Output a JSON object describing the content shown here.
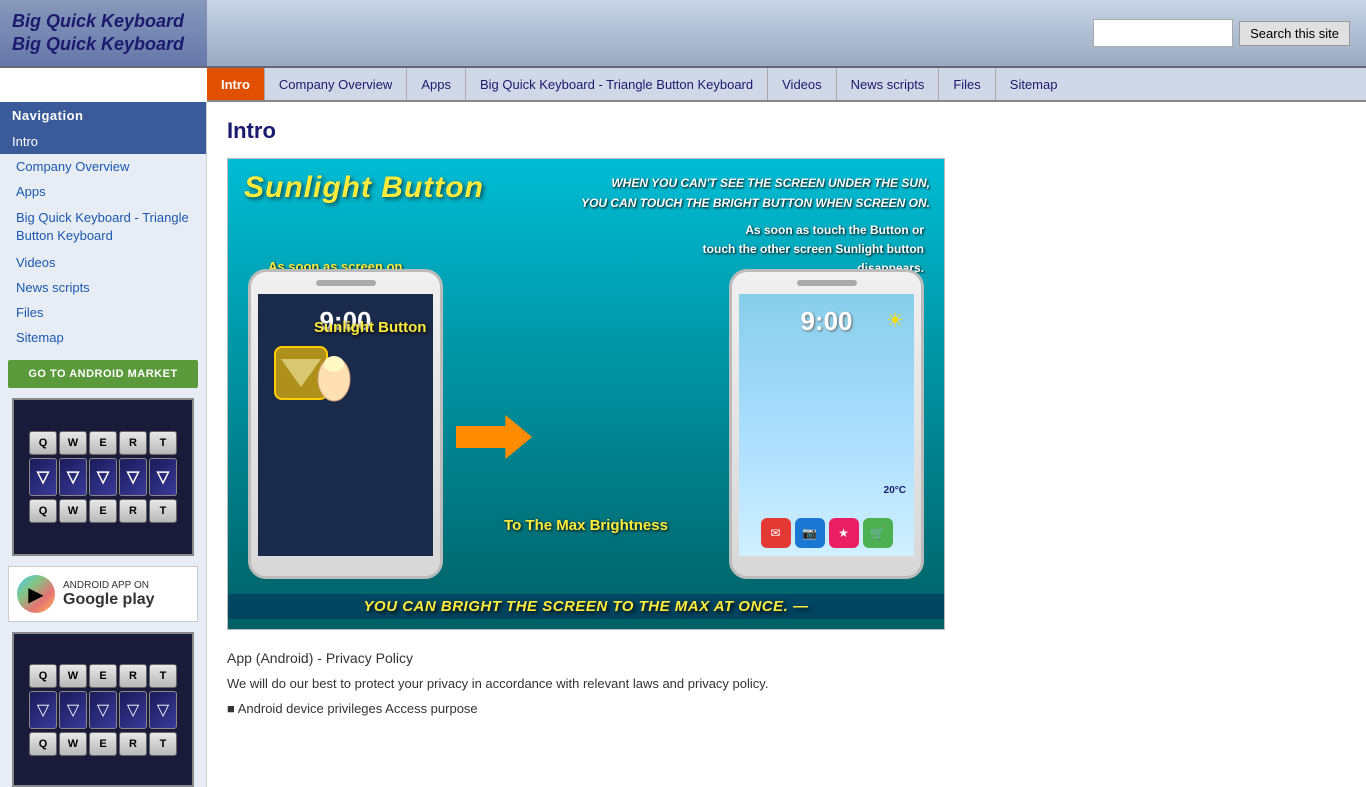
{
  "site": {
    "title": "Big Quick Keyboard Big Quick Keyboard",
    "search_placeholder": "",
    "search_button": "Search this site"
  },
  "navbar": {
    "items": [
      {
        "label": "Intro",
        "active": true
      },
      {
        "label": "Company Overview",
        "active": false
      },
      {
        "label": "Apps",
        "active": false
      },
      {
        "label": "Big Quick Keyboard - Triangle Button Keyboard",
        "active": false
      },
      {
        "label": "Videos",
        "active": false
      },
      {
        "label": "News scripts",
        "active": false
      },
      {
        "label": "Files",
        "active": false
      },
      {
        "label": "Sitemap",
        "active": false
      }
    ]
  },
  "sidebar": {
    "nav_header": "Navigation",
    "intro_label": "Intro",
    "links": [
      {
        "label": "Company Overview"
      },
      {
        "label": "Apps"
      },
      {
        "label": "Big Quick Keyboard - Triangle Button Keyboard"
      },
      {
        "label": "Videos"
      },
      {
        "label": "News scripts"
      },
      {
        "label": "Files"
      },
      {
        "label": "Sitemap"
      }
    ],
    "android_market_button": "GO TO ANDROID MARKET",
    "google_play": {
      "pre_label": "ANDROID APP ON",
      "label": "Google play"
    }
  },
  "main": {
    "page_title": "Intro",
    "hero": {
      "top_caption1": "WHEN YOU CAN'T SEE THE SCREEN UNDER THE SUN,",
      "top_caption2": "YOU CAN TOUCH THE BRIGHT BUTTON WHEN SCREEN ON.",
      "sunlight_label": "Sunlight  Button",
      "as_soon_left": "As soon as screen on\nSunlight Button appears.",
      "as_soon_right": "As soon as touch the Button or\ntouch the other screen Sunlight button\ndisappears.",
      "sunlight_btn_label": "Sunlight Button",
      "max_brightness": "To The Max Brightness",
      "bottom_text": "YOU CAN BRIGHT THE SCREEN TO THE MAX AT ONCE.  —"
    },
    "privacy": {
      "title": "App (Android) - Privacy Policy",
      "body": "We will do our best to protect your privacy in accordance with relevant laws and privacy policy.",
      "android_access": "■ Android device privileges Access purpose"
    }
  }
}
